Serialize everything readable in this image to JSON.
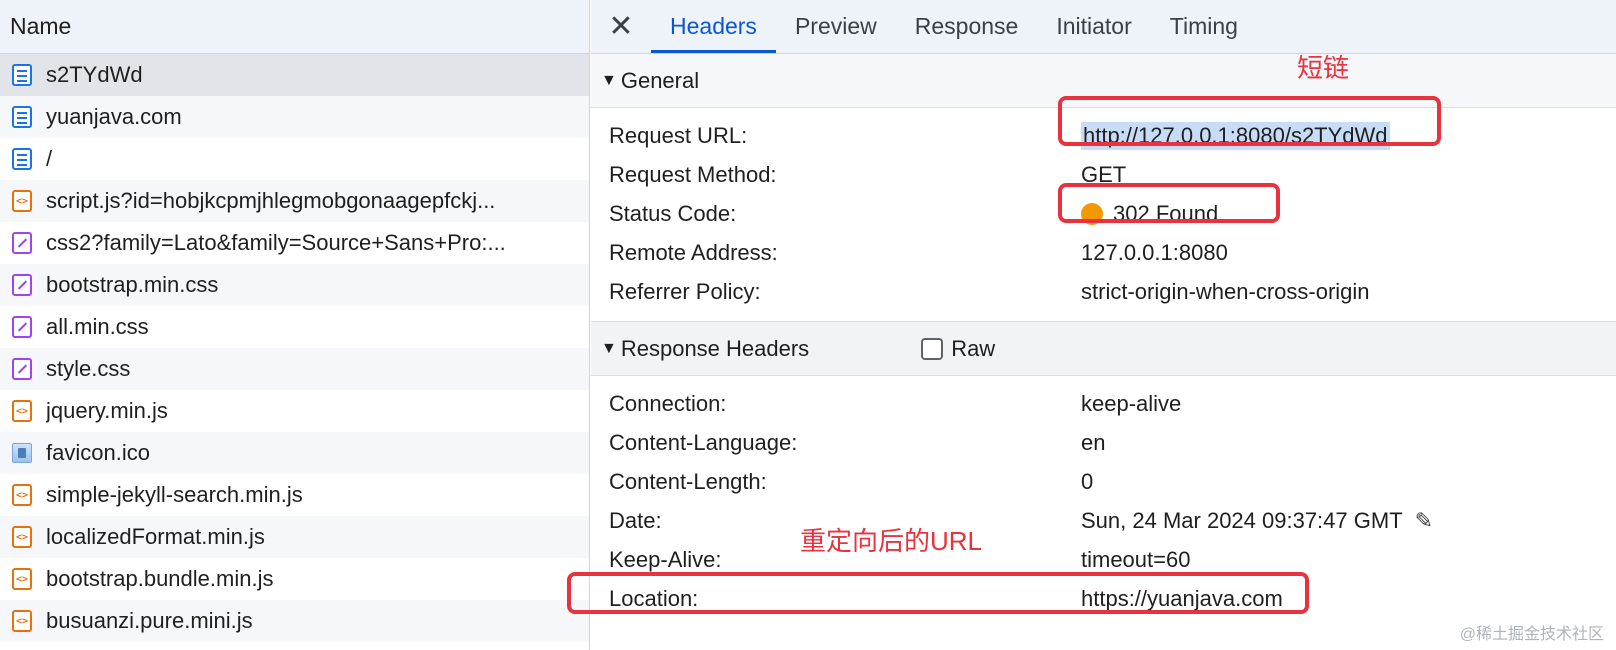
{
  "left": {
    "header": "Name",
    "requests": [
      {
        "name": "s2TYdWd",
        "type": "doc",
        "selected": true
      },
      {
        "name": "yuanjava.com",
        "type": "doc"
      },
      {
        "name": "/",
        "type": "doc"
      },
      {
        "name": "script.js?id=hobjkcpmjhlegmobgonaagepfckj...",
        "type": "script"
      },
      {
        "name": "css2?family=Lato&family=Source+Sans+Pro:...",
        "type": "css"
      },
      {
        "name": "bootstrap.min.css",
        "type": "css"
      },
      {
        "name": "all.min.css",
        "type": "css"
      },
      {
        "name": "style.css",
        "type": "css"
      },
      {
        "name": "jquery.min.js",
        "type": "script"
      },
      {
        "name": "favicon.ico",
        "type": "img"
      },
      {
        "name": "simple-jekyll-search.min.js",
        "type": "script"
      },
      {
        "name": "localizedFormat.min.js",
        "type": "script"
      },
      {
        "name": "bootstrap.bundle.min.js",
        "type": "script"
      },
      {
        "name": "busuanzi.pure.mini.js",
        "type": "script"
      }
    ]
  },
  "tabs": [
    {
      "label": "Headers",
      "active": true
    },
    {
      "label": "Preview"
    },
    {
      "label": "Response"
    },
    {
      "label": "Initiator"
    },
    {
      "label": "Timing"
    }
  ],
  "general": {
    "title": "General",
    "rows": [
      {
        "key": "Request URL:",
        "value": "http://127.0.0.1:8080/s2TYdWd"
      },
      {
        "key": "Request Method:",
        "value": "GET"
      },
      {
        "key": "Status Code:",
        "value": "302 Found",
        "status_color": "#f29900"
      },
      {
        "key": "Remote Address:",
        "value": "127.0.0.1:8080"
      },
      {
        "key": "Referrer Policy:",
        "value": "strict-origin-when-cross-origin"
      }
    ]
  },
  "response_headers": {
    "title": "Response Headers",
    "raw_label": "Raw",
    "raw_checked": false,
    "rows": [
      {
        "key": "Connection:",
        "value": "keep-alive"
      },
      {
        "key": "Content-Language:",
        "value": "en"
      },
      {
        "key": "Content-Length:",
        "value": "0"
      },
      {
        "key": "Date:",
        "value": "Sun, 24 Mar 2024 09:37:47 GMT"
      },
      {
        "key": "Keep-Alive:",
        "value": "timeout=60"
      },
      {
        "key": "Location:",
        "value": "https://yuanjava.com"
      }
    ]
  },
  "annotations": {
    "short_link": "短链",
    "redirect_url": "重定向后的URL",
    "accent_color": "#e8333f"
  },
  "watermark": "@稀土掘金技术社区"
}
